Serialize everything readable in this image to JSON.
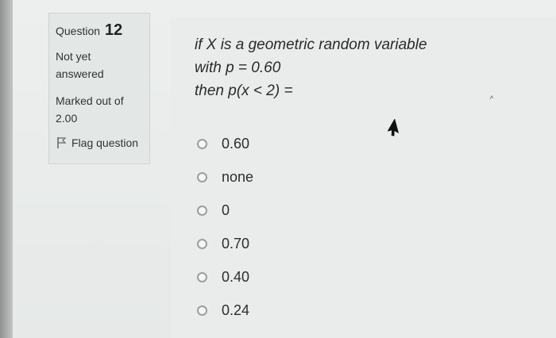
{
  "question_info": {
    "question_word": "Question",
    "question_number": "12",
    "state": "Not yet answered",
    "marks": "Marked out of 2.00",
    "flag_label": "Flag question"
  },
  "question": {
    "lines": [
      "if X is a geometric random variable",
      "with p = 0.60",
      "then p(x < 2) ="
    ]
  },
  "answers": [
    {
      "label": "0.60"
    },
    {
      "label": "none"
    },
    {
      "label": "0"
    },
    {
      "label": "0.70"
    },
    {
      "label": "0.40"
    },
    {
      "label": "0.24"
    }
  ],
  "icons": {
    "flag": "flag-icon",
    "radio": "radio-icon",
    "cursor": "mouse-pointer-icon"
  },
  "colors": {
    "background": "#ecefee",
    "card": "#e3e7e6",
    "text": "#333333"
  }
}
